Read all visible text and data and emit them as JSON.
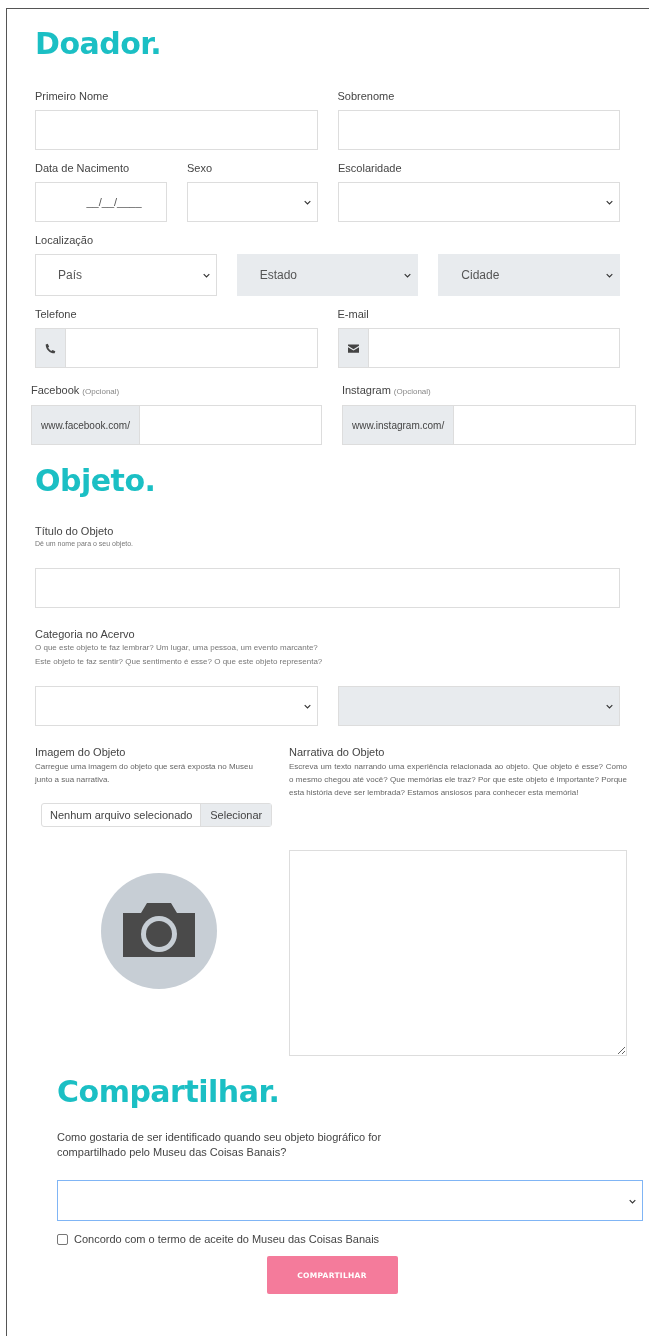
{
  "donor": {
    "title": "Doador.",
    "rows": [
      {
        "fields": [
          {
            "label": "Primeiro Nome",
            "kind": "text",
            "disabled": false
          },
          {
            "label": "Sobrenome",
            "kind": "text",
            "disabled": false
          }
        ]
      },
      {
        "fields": [
          {
            "label": "Data de Nacimento",
            "kind": "date",
            "placeholder": "__/__/____",
            "disabled": false
          },
          {
            "label": "Sexo",
            "kind": "select",
            "disabled": false
          },
          {
            "label": "Escolaridade",
            "kind": "select",
            "disabled": false
          }
        ]
      },
      {
        "label": "Localização",
        "fields": [
          {
            "kind": "select",
            "value": "País",
            "disabled": false
          },
          {
            "kind": "select",
            "value": "Estado",
            "disabled": true
          },
          {
            "kind": "select",
            "value": "Cidade",
            "disabled": true
          }
        ]
      },
      {
        "fields": [
          {
            "label": "Telefone",
            "kind": "phone"
          },
          {
            "label": "E-mail",
            "kind": "email"
          }
        ]
      },
      {
        "fields": [
          {
            "label": "Facebook",
            "note": "(Opcional)",
            "kind": "prefix",
            "prefix": "www.facebook.com/"
          },
          {
            "label": "Instagram",
            "note": "(Opcional)",
            "kind": "prefix",
            "prefix": "www.instagram.com/"
          }
        ]
      }
    ]
  },
  "object": {
    "title": "Objeto.",
    "name_field": {
      "label": "Título do Objeto",
      "hints": [
        "Dê um nome para o seu objeto."
      ]
    },
    "category": {
      "label": "Categoria no Acervo",
      "hints": [
        "O que este objeto te faz lembrar? Um lugar, uma pessoa, um evento marcante?",
        "Este objeto te faz sentir? Que sentimento é esse? O que este objeto representa?"
      ],
      "selects": [
        {
          "disabled": false
        },
        {
          "disabled": true
        }
      ]
    },
    "image": {
      "label": "Imagem do Objeto",
      "description": "Carregue uma imagem do objeto que será exposta no Museu junto a sua narrativa.",
      "file_status": "Nenhum arquivo selecionado",
      "file_button": "Selecionar"
    },
    "narrative": {
      "label": "Narrativa do Objeto",
      "description": "Escreva um texto narrando uma experiência relacionada ao objeto. Que objeto é esse? Como o mesmo chegou até você? Que memórias ele traz? Por que este objeto é importante? Porque esta história deve ser lembrada? Estamos ansiosos para conhecer esta memória!"
    }
  },
  "share": {
    "title": "Compartilhar.",
    "question": "Como gostaria de ser identificado quando seu objeto biográfico for compartilhado pelo Museu das Coisas Banais?",
    "select": {
      "focused": true
    },
    "agree": {
      "label": "Concordo com o termo de aceite do Museu das Coisas Banais",
      "checked": false
    },
    "button": "COMPARTILHAR"
  }
}
